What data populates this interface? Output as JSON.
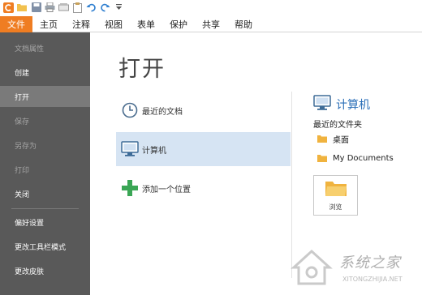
{
  "quick_access": {
    "icons": [
      "app-logo-icon",
      "open-folder-icon",
      "save-icon",
      "print-icon",
      "scan-icon",
      "clipboard-icon",
      "undo-icon",
      "redo-icon",
      "customize-dropdown-icon"
    ]
  },
  "ribbon": {
    "tabs": [
      "文件",
      "主页",
      "注释",
      "视图",
      "表单",
      "保护",
      "共享",
      "帮助"
    ],
    "active_tab_color": "#ef7d22"
  },
  "sidebar": {
    "items": [
      {
        "label": "文档属性",
        "enabled": false
      },
      {
        "label": "创建",
        "enabled": true
      },
      {
        "label": "打开",
        "enabled": true,
        "active": true
      },
      {
        "label": "保存",
        "enabled": false
      },
      {
        "label": "另存为",
        "enabled": false
      },
      {
        "label": "打印",
        "enabled": false
      },
      {
        "label": "关闭",
        "enabled": true
      },
      {
        "label": "偏好设置",
        "enabled": true
      },
      {
        "label": "更改工具栏模式",
        "enabled": true
      },
      {
        "label": "更改皮肤",
        "enabled": true
      }
    ],
    "background": "#595959"
  },
  "main": {
    "title": "打开",
    "places": [
      {
        "label": "最近的文档",
        "icon": "clock-icon"
      },
      {
        "label": "计算机",
        "icon": "computer-icon",
        "selected": true
      },
      {
        "label": "添加一个位置",
        "icon": "plus-icon"
      }
    ],
    "right_panel": {
      "title": "计算机",
      "recent_folders_label": "最近的文件夹",
      "folders": [
        "桌面",
        "My Documents"
      ],
      "browse_label": "浏览"
    }
  },
  "watermark": {
    "text": "系统之家",
    "sub": "XITONGZHIJIA.NET"
  },
  "colors": {
    "accent": "#ef7d22",
    "selection": "#d6e4f3",
    "link_blue": "#2b6fb8"
  }
}
